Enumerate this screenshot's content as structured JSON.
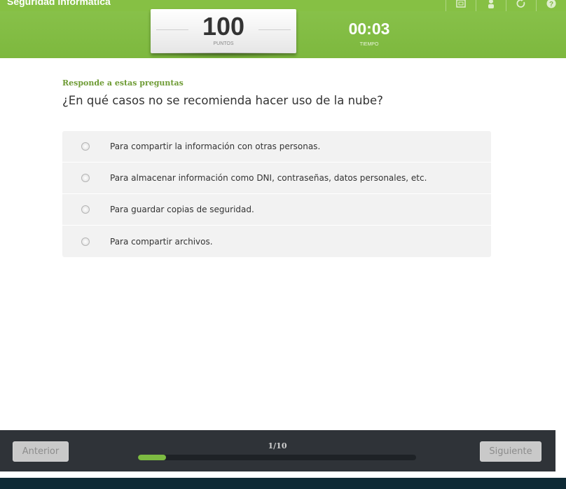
{
  "header": {
    "title": "Seguridad informática",
    "icons": [
      "fullscreen-icon",
      "users-icon",
      "reload-icon",
      "help-icon"
    ]
  },
  "score": {
    "value": "100",
    "label": "PUNTOS"
  },
  "timer": {
    "value": "00:03",
    "label": "TIEMPO"
  },
  "quiz": {
    "instruction": "Responde a estas preguntas",
    "question": "¿En qué casos no se recomienda hacer uso de la nube?",
    "options": [
      "Para compartir la información con otras personas.",
      "Para almacenar información como DNI, contraseñas, datos personales, etc.",
      "Para guardar copias de seguridad.",
      "Para compartir archivos."
    ]
  },
  "footer": {
    "prev_label": "Anterior",
    "next_label": "Siguiente",
    "progress_text": "1/10",
    "progress_fraction": 0.1
  },
  "colors": {
    "header_green": "#7db83e",
    "footer_dark": "#2f3338",
    "progress_green": "#7dbb42",
    "instruction_green": "#6e9b34"
  }
}
